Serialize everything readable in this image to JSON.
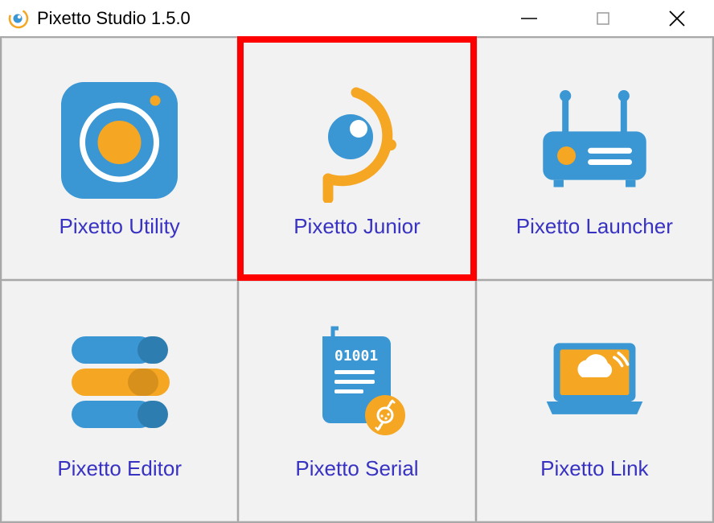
{
  "window": {
    "title": "Pixetto Studio 1.5.0"
  },
  "tiles": [
    {
      "label": "Pixetto Utility"
    },
    {
      "label": "Pixetto Junior"
    },
    {
      "label": "Pixetto Launcher"
    },
    {
      "label": "Pixetto Editor"
    },
    {
      "label": "Pixetto Serial"
    },
    {
      "label": "Pixetto Link"
    }
  ],
  "colors": {
    "brand_blue": "#3a97d4",
    "brand_yellow": "#f5a623",
    "label_purple": "#3832c2",
    "highlight": "#ff0000"
  }
}
